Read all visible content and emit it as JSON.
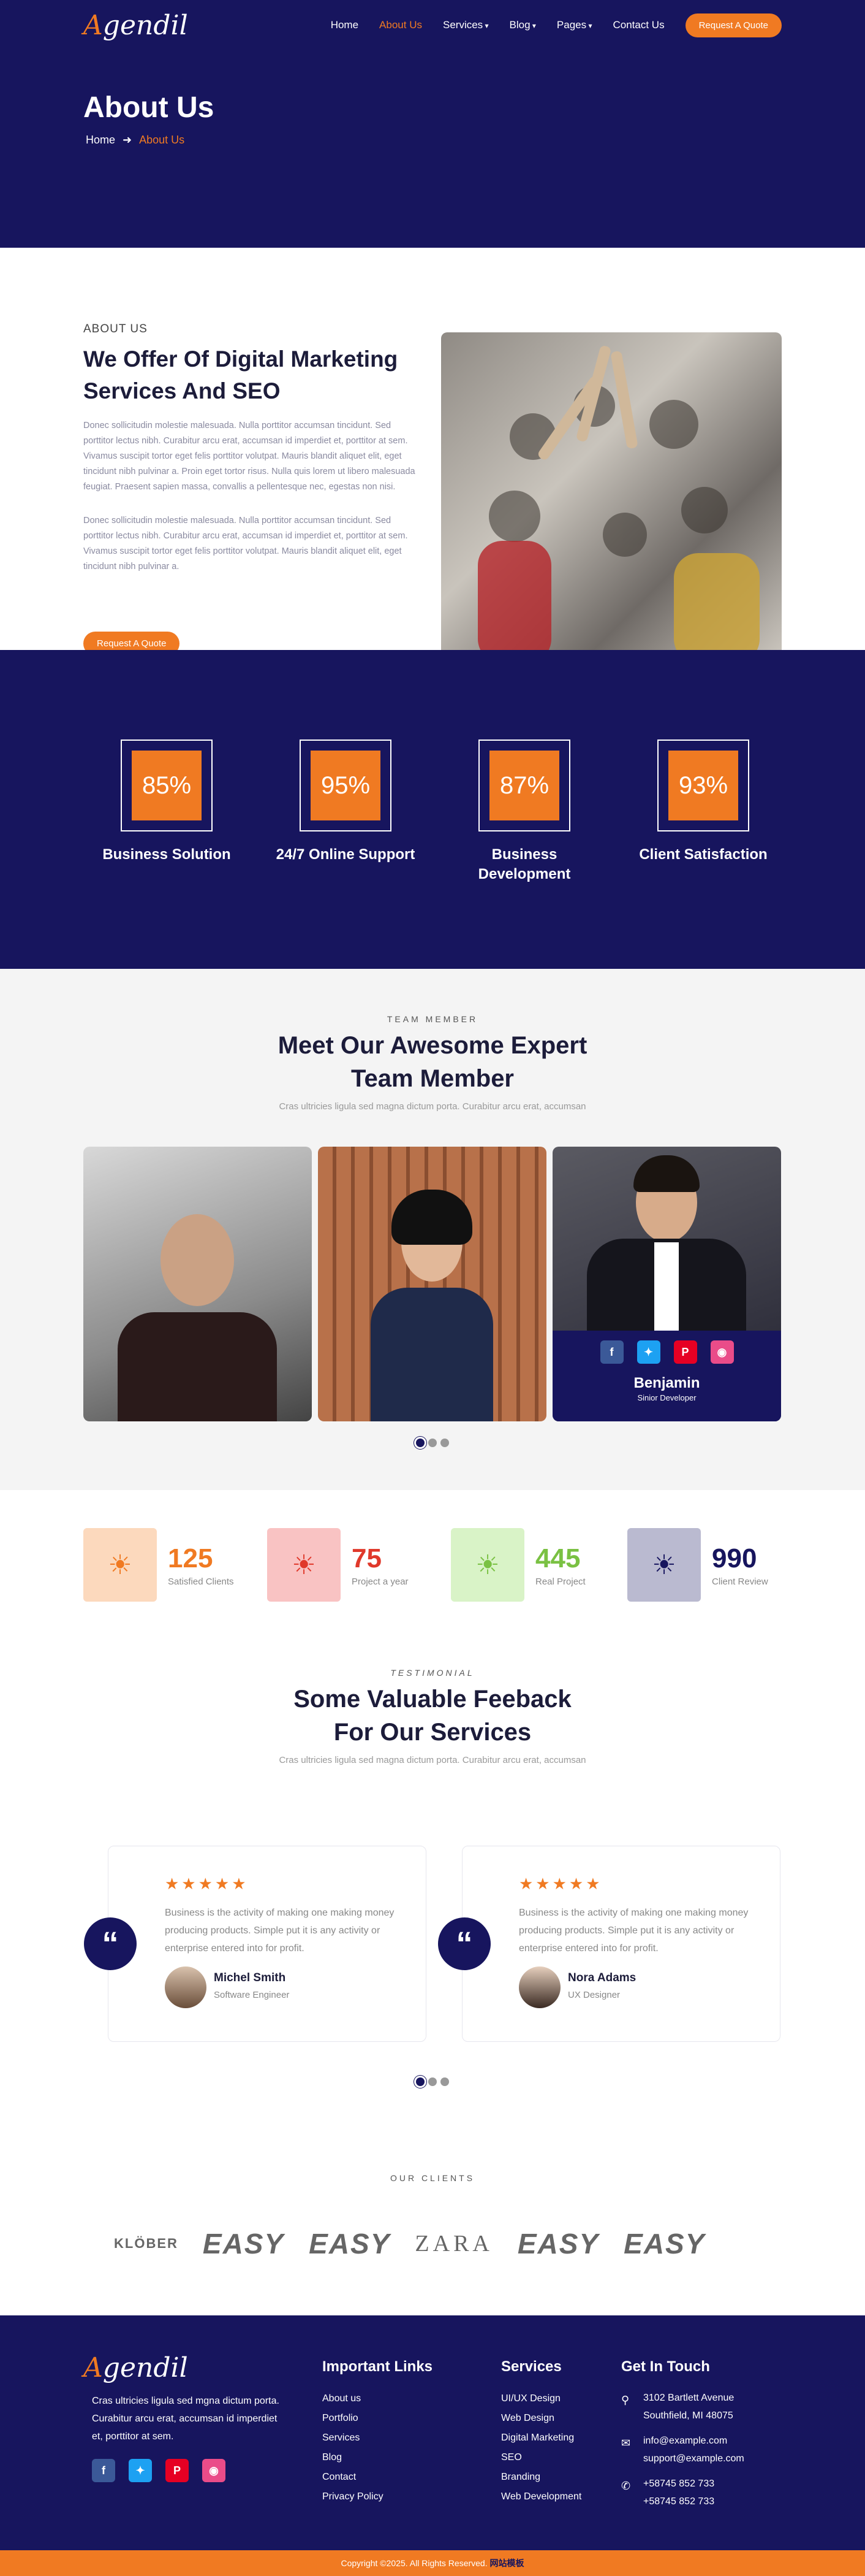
{
  "header": {
    "logo_first": "A",
    "logo_rest": "gendil",
    "nav": [
      {
        "label": "Home",
        "active": false,
        "dropdown": false
      },
      {
        "label": "About Us",
        "active": true,
        "dropdown": false
      },
      {
        "label": "Services",
        "active": false,
        "dropdown": true
      },
      {
        "label": "Blog",
        "active": false,
        "dropdown": true
      },
      {
        "label": "Pages",
        "active": false,
        "dropdown": true
      },
      {
        "label": "Contact Us",
        "active": false,
        "dropdown": false
      }
    ],
    "cta": "Request A Quote",
    "title": "About Us",
    "breadcrumb_home": "Home",
    "breadcrumb_current": "About Us"
  },
  "about": {
    "eyebrow": "ABOUT US",
    "heading": "We Offer Of Digital Marketing Services And SEO",
    "para1": "Donec sollicitudin molestie malesuada. Nulla porttitor accumsan tincidunt. Sed porttitor lectus nibh. Curabitur arcu erat, accumsan id imperdiet et, porttitor at sem. Vivamus suscipit tortor eget felis porttitor volutpat. Mauris blandit aliquet elit, eget tincidunt nibh pulvinar a. Proin eget tortor risus. Nulla quis lorem ut libero malesuada feugiat. Praesent sapien massa, convallis a pellentesque nec, egestas non nisi.",
    "para2": "Donec sollicitudin molestie malesuada. Nulla porttitor accumsan tincidunt. Sed porttitor lectus nibh. Curabitur arcu erat, accumsan id imperdiet et, porttitor at sem. Vivamus suscipit tortor eget felis porttitor volutpat. Mauris blandit aliquet elit, eget tincidunt nibh pulvinar a.",
    "cta": "Request A Quote"
  },
  "stats": [
    {
      "value": "85%",
      "label": "Business Solution"
    },
    {
      "value": "95%",
      "label": "24/7 Online Support"
    },
    {
      "value": "87%",
      "label": "Business Development"
    },
    {
      "value": "93%",
      "label": "Client Satisfaction"
    }
  ],
  "team": {
    "eyebrow": "TEAM MEMBER",
    "heading": "Meet Our Awesome Expert Team Member",
    "sub": "Cras ultricies ligula sed magna dictum porta. Curabitur arcu erat, accumsan",
    "featured_name": "Benjamin",
    "featured_role": "Sinior Developer"
  },
  "counters": [
    {
      "value": "125",
      "label": "Satisfied Clients",
      "color": "#f07a22",
      "bg": "#fcd9bd"
    },
    {
      "value": "75",
      "label": "Project a year",
      "color": "#e0392b",
      "bg": "#f9c3c3"
    },
    {
      "value": "445",
      "label": "Real Project",
      "color": "#7ac143",
      "bg": "#d9f3c7"
    },
    {
      "value": "990",
      "label": "Client Review",
      "color": "#17155e",
      "bg": "#babad0"
    }
  ],
  "testimonial": {
    "eyebrow": "TESTIMONIAL",
    "heading": "Some Valuable Feeback For Our Services",
    "sub": "Cras ultricies ligula sed magna dictum porta. Curabitur arcu erat, accumsan",
    "items": [
      {
        "quote": "Business is the activity of making one making money producing products. Simple put it is any activity or enterprise entered into for profit.",
        "name": "Michel Smith",
        "role": "Software Engineer"
      },
      {
        "quote": "Business is the activity of making one making money producing products. Simple put it is any activity or enterprise entered into for profit.",
        "name": "Nora Adams",
        "role": "UX Designer"
      }
    ]
  },
  "clients": {
    "eyebrow": "OUR CLIENTS",
    "logos": [
      "KLÖBER",
      "EASY",
      "EASY",
      "ZARA",
      "EASY",
      "EASY"
    ]
  },
  "footer": {
    "about": "Cras ultricies ligula sed mgna dictum porta. Curabitur arcu erat, accumsan id imperdiet et, porttitor at sem.",
    "links_title": "Important Links",
    "links": [
      "About us",
      "Portfolio",
      "Services",
      "Blog",
      "Contact",
      "Privacy Policy"
    ],
    "services_title": "Services",
    "services": [
      "UI/UX Design",
      "Web Design",
      "Digital Marketing",
      "SEO",
      "Branding",
      "Web Development"
    ],
    "contact_title": "Get In Touch",
    "address1": "3102 Bartlett Avenue",
    "address2": "Southfield, MI 48075",
    "email1": "info@example.com",
    "email2": "support@example.com",
    "phone1": "+58745 852 733",
    "phone2": "+58745 852 733",
    "copyright": "Copyright ©2025. All Rights Reserved.",
    "copyright_link": "网站模板"
  }
}
